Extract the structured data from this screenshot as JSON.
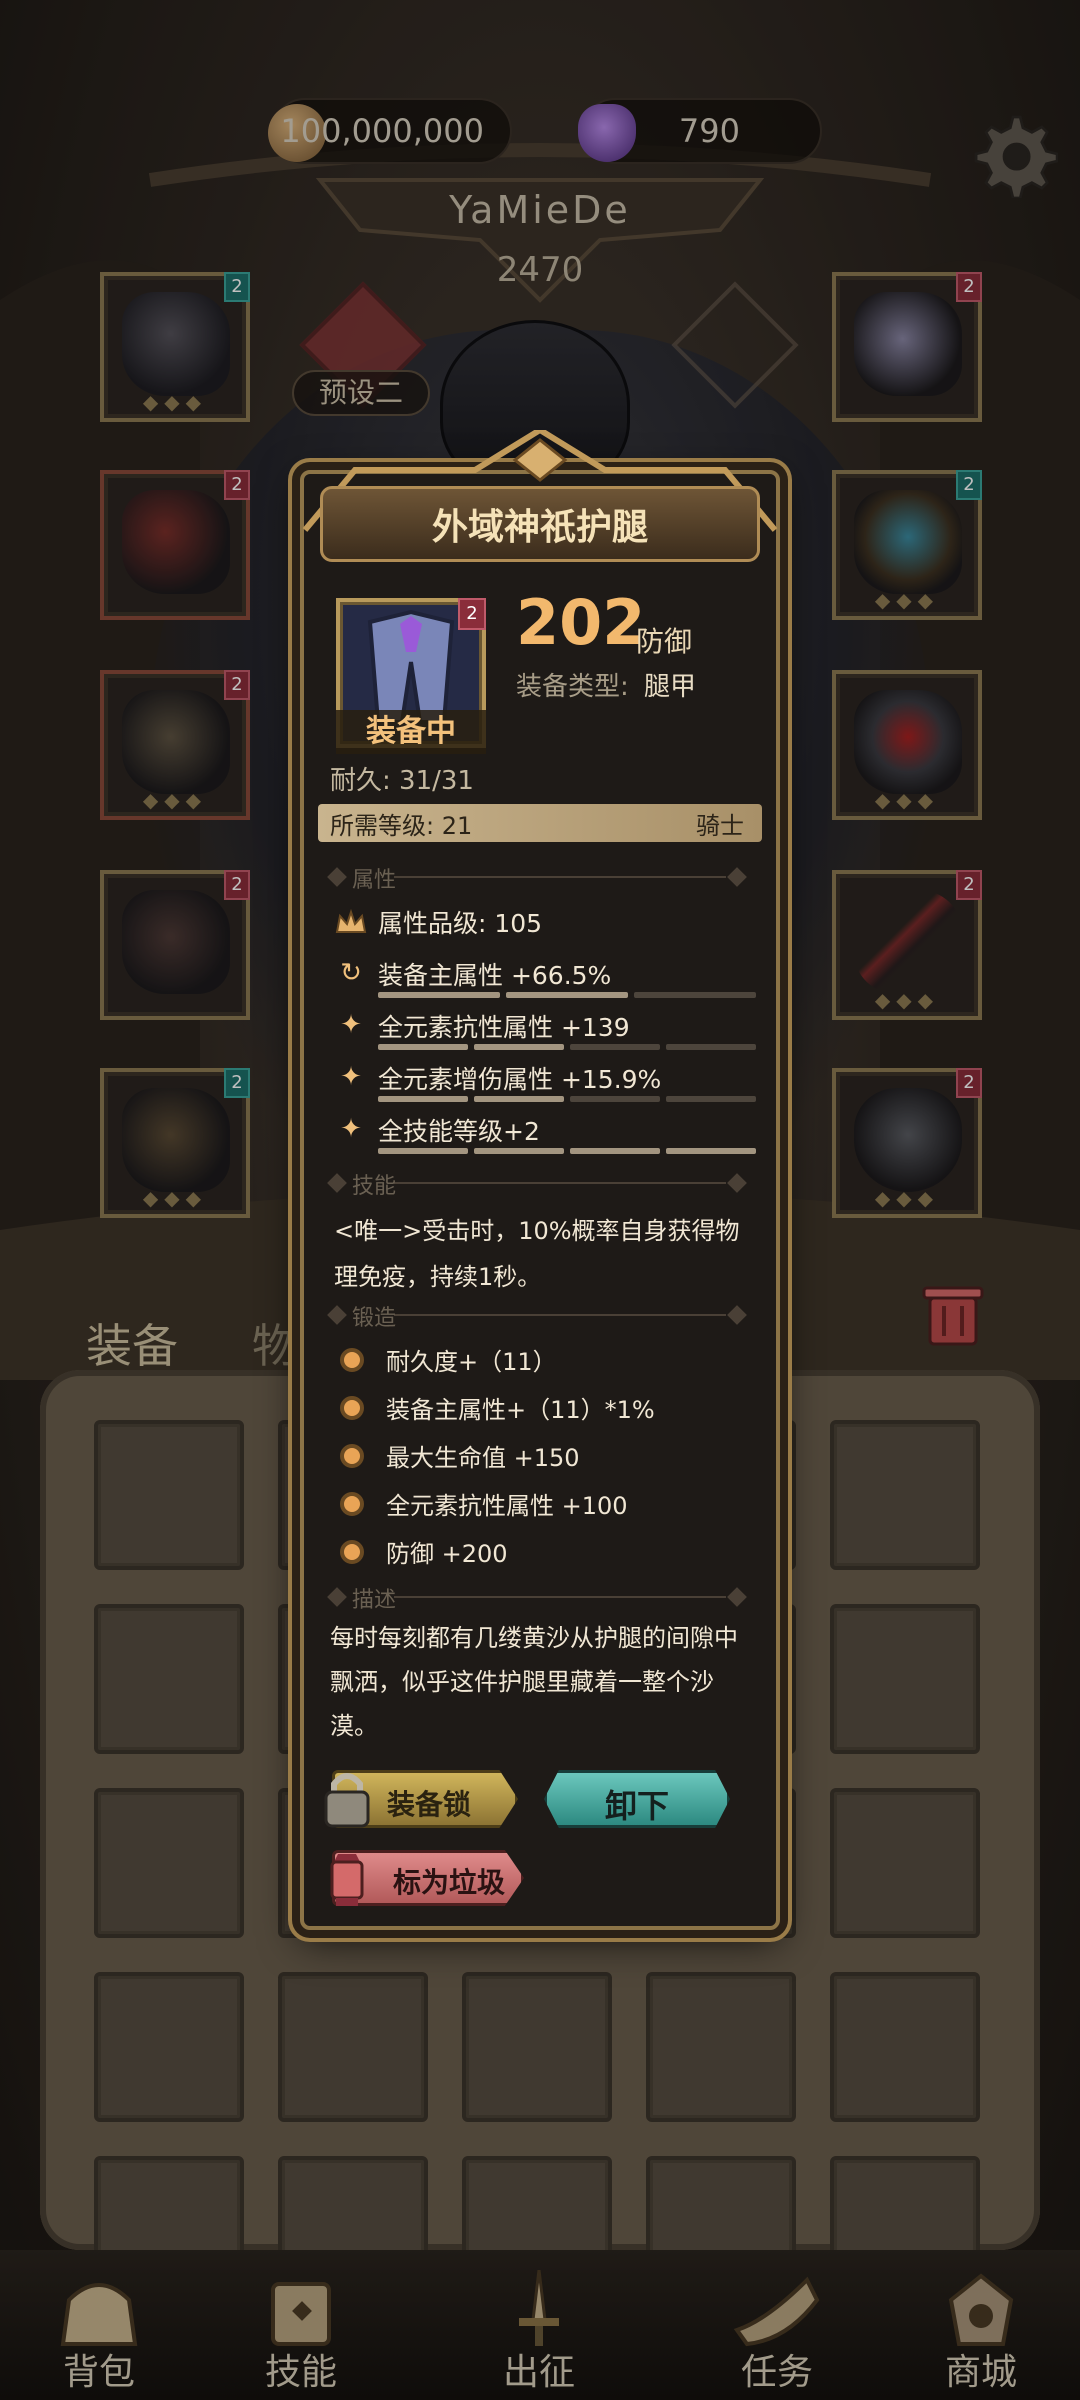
{
  "currency": {
    "gold": "100,000,000",
    "gems": "790"
  },
  "player": {
    "name": "YaMieDe",
    "power": "2470",
    "preset": "预设二"
  },
  "equipment_slots": {
    "left": [
      {
        "tier": "2",
        "tier_color": "#1c6f6a"
      },
      {
        "tier": "2",
        "tier_color": "#8a2d3a"
      },
      {
        "tier": "2",
        "tier_color": "#8a2d3a"
      },
      {
        "tier": "2",
        "tier_color": "#8a2d3a"
      },
      {
        "tier": "2",
        "tier_color": "#1c6f6a"
      }
    ],
    "right": [
      {
        "tier": "2",
        "tier_color": "#8a2d3a"
      },
      {
        "tier": "2",
        "tier_color": "#1c6f6a"
      },
      {
        "tier": "",
        "tier_color": ""
      },
      {
        "tier": "2",
        "tier_color": "#8a2d3a"
      },
      {
        "tier": "2",
        "tier_color": "#8a2d3a"
      }
    ]
  },
  "tabs": {
    "equipment": "装备",
    "items": "物品"
  },
  "item": {
    "name": "外域神祇护腿",
    "tier": "2",
    "equipped_label": "装备中",
    "defense_value": "202",
    "defense_label": "防御",
    "type_label": "装备类型:",
    "type_value": "腿甲",
    "durability": "耐久: 31/31",
    "required_level": "所需等级: 21",
    "required_class": "骑士"
  },
  "sections": {
    "attributes": "属性",
    "skills": "技能",
    "forging": "锻造",
    "description": "描述"
  },
  "attributes": [
    {
      "icon": "crown-icon",
      "text": "属性品级: 105",
      "fill": null
    },
    {
      "icon": "cycle-icon",
      "text": "装备主属性 +66.5%",
      "fill": 0.67
    },
    {
      "icon": "star-icon",
      "text": "全元素抗性属性 +139",
      "fill": 0.5
    },
    {
      "icon": "star-icon",
      "text": "全元素增伤属性 +15.9%",
      "fill": 0.5
    },
    {
      "icon": "star-icon",
      "text": "全技能等级+2",
      "fill": 1.0
    }
  ],
  "skill_text": "<唯一>受击时，10%概率自身获得物理免疫，持续1秒。",
  "forging": [
    "耐久度+（11）",
    "装备主属性+（11）*1%",
    "最大生命值 +150",
    "全元素抗性属性 +100",
    "防御 +200"
  ],
  "description": "每时每刻都有几缕黄沙从护腿的间隙中飘洒，似乎这件护腿里藏着一整个沙漠。",
  "buttons": {
    "lock": "装备锁",
    "unequip": "卸下",
    "mark_trash": "标为垃圾"
  },
  "nav": [
    {
      "label": "背包",
      "icon": "bag-icon"
    },
    {
      "label": "技能",
      "icon": "scroll-icon"
    },
    {
      "label": "出征",
      "icon": "sword-icon"
    },
    {
      "label": "任务",
      "icon": "horn-icon"
    },
    {
      "label": "商城",
      "icon": "shop-icon"
    }
  ],
  "colors": {
    "accent_gold": "#f2b86d",
    "button_lock": "#d0b55b",
    "button_unequip": "#6bc7bd",
    "button_trash": "#df8a8a",
    "tier_red": "#8a2d3a",
    "tier_teal": "#1c6f6a"
  }
}
